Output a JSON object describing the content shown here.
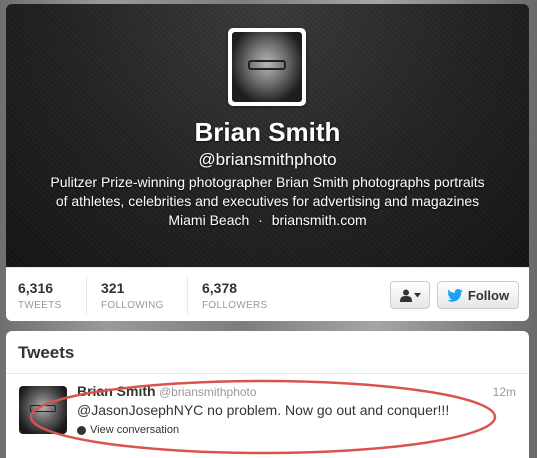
{
  "profile": {
    "name": "Brian Smith",
    "handle": "@briansmithphoto",
    "bio_line1": "Pulitzer Prize-winning photographer Brian Smith photographs portraits",
    "bio_line2": "of athletes, celebrities and executives for advertising and magazines",
    "location": "Miami Beach",
    "separator": "·",
    "website": "briansmith.com"
  },
  "stats": [
    {
      "value": "6,316",
      "label": "TWEETS"
    },
    {
      "value": "321",
      "label": "FOLLOWING"
    },
    {
      "value": "6,378",
      "label": "FOLLOWERS"
    }
  ],
  "actions": {
    "user_menu_icon": "person-icon",
    "follow_label": "Follow",
    "follow_icon": "twitter-bird-icon"
  },
  "tweets_section": {
    "title": "Tweets"
  },
  "tweet": {
    "author_name": "Brian Smith",
    "author_handle": "@briansmithphoto",
    "time": "12m",
    "text": "@JasonJosephNYC no problem. Now go out and conquer!!!",
    "view_conversation": "View conversation"
  },
  "colors": {
    "twitter_blue": "#1da1f2",
    "highlight_ellipse": "#d9534f"
  }
}
